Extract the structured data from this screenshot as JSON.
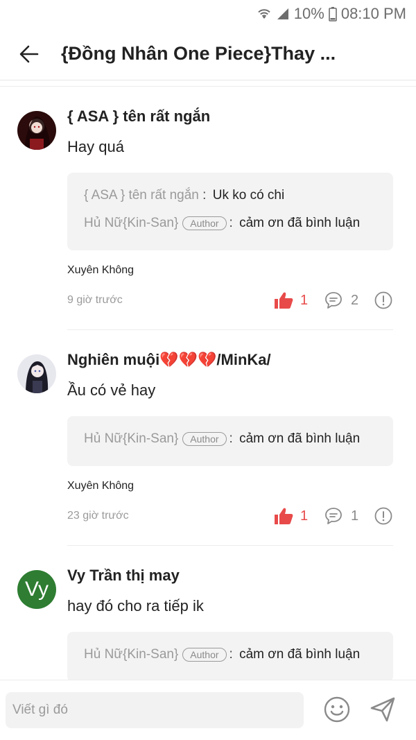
{
  "status_bar": {
    "battery": "10%",
    "time": "08:10 PM"
  },
  "header": {
    "title": "{Đồng Nhân One Piece}Thay ..."
  },
  "comments": [
    {
      "user": "{ ASA } tên rất ngắn",
      "text": "Hay quá",
      "replies": [
        {
          "author": "{ ASA } tên rất ngắn",
          "badge": "",
          "content": "Uk ko có chi"
        },
        {
          "author": "Hủ Nữ{Kin-San}",
          "badge": "Author",
          "content": "cảm ơn đã bình luận"
        }
      ],
      "tag": "Xuyên Không",
      "time": "9 giờ trước",
      "likes": "1",
      "reply_count": "2"
    },
    {
      "user": "Nghiên muội💔💔💔/MinKa/",
      "text": "Ầu có vẻ hay",
      "replies": [
        {
          "author": "Hủ Nữ{Kin-San}",
          "badge": "Author",
          "content": "cảm ơn đã bình luận"
        }
      ],
      "tag": "Xuyên Không",
      "time": "23 giờ trước",
      "likes": "1",
      "reply_count": "1"
    },
    {
      "user": "Vy Trần thị may",
      "avatar_letter": "Vy",
      "text": "hay đó cho ra tiếp ik",
      "replies": [
        {
          "author": "Hủ Nữ{Kin-San}",
          "badge": "Author",
          "content": "cảm ơn đã bình luận"
        }
      ]
    }
  ],
  "input": {
    "placeholder": "Viết gì đó"
  },
  "colors": {
    "like": "#e84a4a",
    "avatar_green": "#2e7d32",
    "reply_bg": "#f3f3f3"
  }
}
